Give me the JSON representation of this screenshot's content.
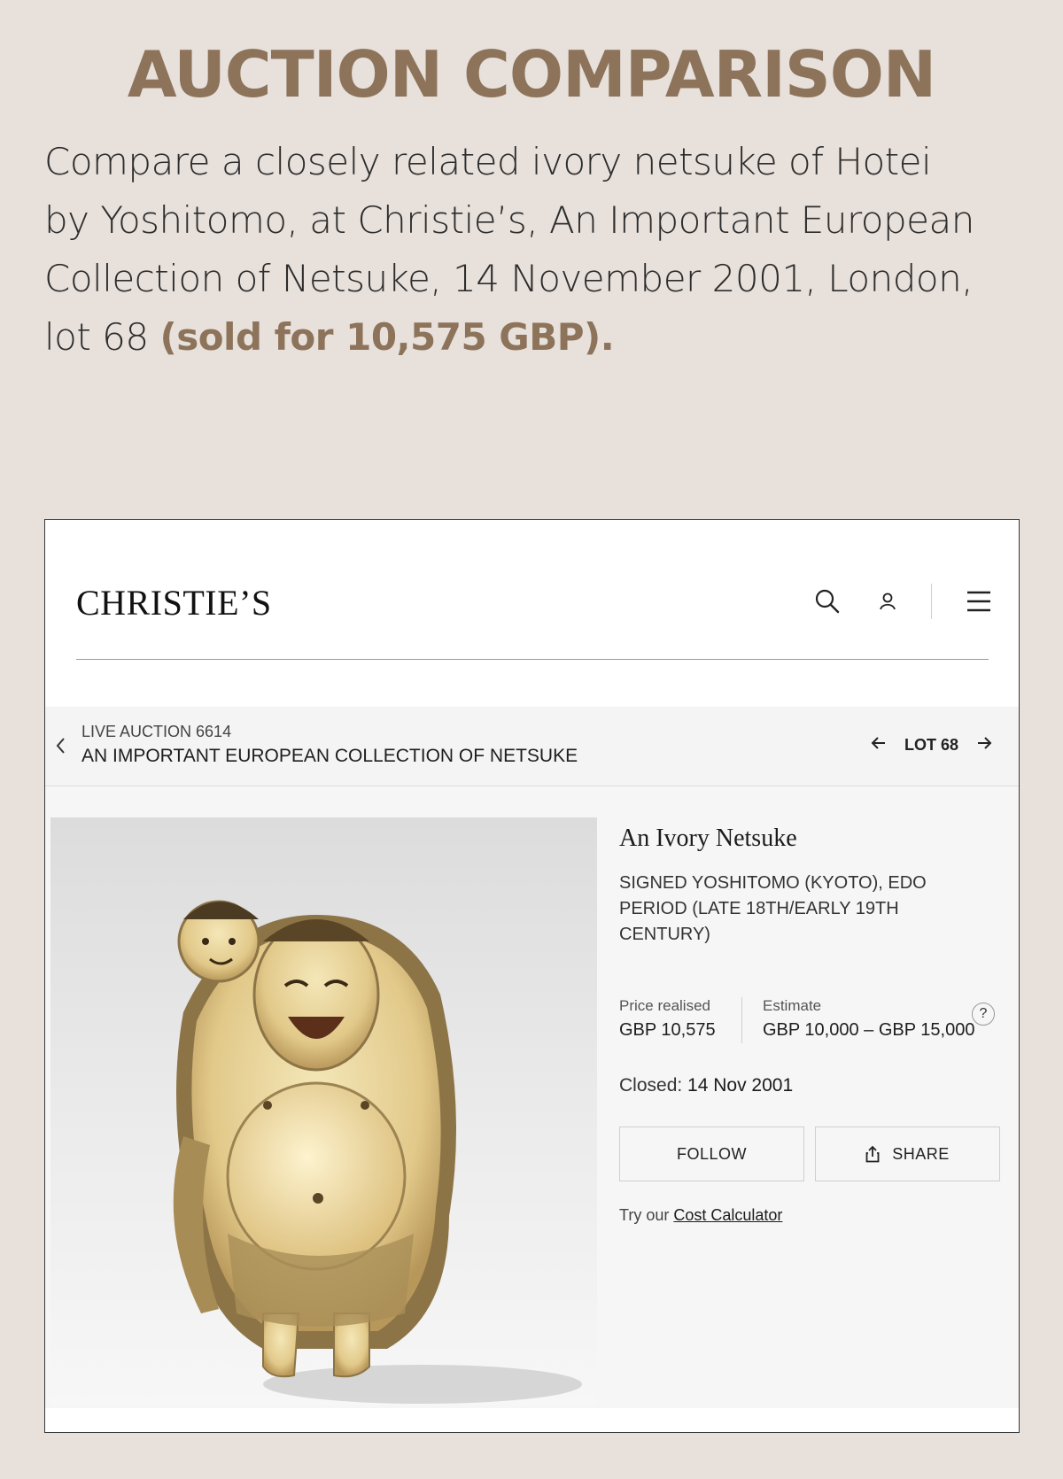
{
  "page": {
    "heading": "AUCTION COMPARISON",
    "intro_lines": [
      "Compare a closely related ivory netsuke of Hotei",
      "by Yoshitomo, at Christie’s, An Important European",
      "Collection of Netsuke, 14 November 2001, London,",
      "lot 68"
    ],
    "sold_text": "(sold for 10,575 GBP)."
  },
  "screenshot": {
    "logo": "CHRISTIE’S",
    "header_icons": [
      "search-icon",
      "user-icon",
      "menu-icon"
    ],
    "auction": {
      "code": "LIVE AUCTION 6614",
      "title": "AN IMPORTANT EUROPEAN COLLECTION OF NETSUKE",
      "lot_label": "LOT 68"
    },
    "lot": {
      "title": "An Ivory Netsuke",
      "subtitle": "SIGNED YOSHITOMO (KYOTO), EDO PERIOD (LATE 18TH/EARLY 19TH CENTURY)",
      "price_label": "Price realised",
      "price_value": "GBP 10,575",
      "estimate_label": "Estimate",
      "estimate_value": "GBP 10,000 – GBP 15,000",
      "help": "?",
      "closed_label": "Closed:",
      "closed_value": "14 Nov 2001",
      "follow_label": "FOLLOW",
      "share_label": "SHARE",
      "calc_prefix": "Try our",
      "calc_link": "Cost Calculator"
    }
  },
  "colors": {
    "accent": "#8c735a",
    "background": "#e7e0db"
  }
}
